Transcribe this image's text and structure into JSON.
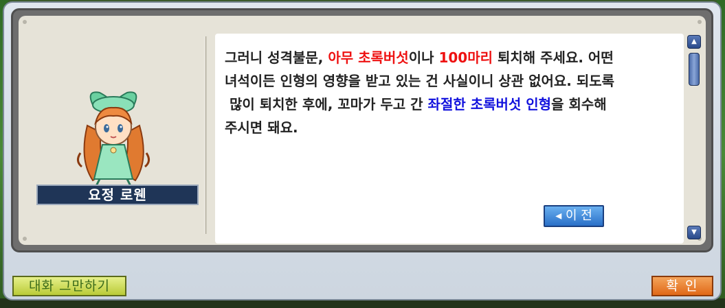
{
  "npc": {
    "name": "요정 로웬"
  },
  "dialog": {
    "line1": [
      {
        "text": "그러니 성격불문, ",
        "style": "normal"
      },
      {
        "text": "아무 초록버섯",
        "style": "red"
      },
      {
        "text": "이나 ",
        "style": "normal"
      },
      {
        "text": "100마리",
        "style": "red"
      },
      {
        "text": " 퇴치해 주세요. 어떤",
        "style": "normal"
      }
    ],
    "line2": "녀석이든 인형의 영향을 받고 있는 건 사실이니 상관 없어요. 되도록",
    "line3": [
      {
        "text": " 많이 퇴치한 후에, 꼬마가 두고 간 ",
        "style": "normal"
      },
      {
        "text": "좌절한 초록버섯 인형",
        "style": "blue"
      },
      {
        "text": "을 회수해",
        "style": "normal"
      }
    ],
    "line4": "주시면 돼요."
  },
  "buttons": {
    "prev": "◂ 이 전",
    "end_chat": "대화 그만하기",
    "ok": "확 인"
  },
  "icons": {
    "scroll_up": "scroll-up-icon",
    "scroll_down": "scroll-down-icon"
  },
  "colors": {
    "highlight_red": "#ee1111",
    "highlight_blue": "#1111dd",
    "name_plate": "#1f3557"
  }
}
